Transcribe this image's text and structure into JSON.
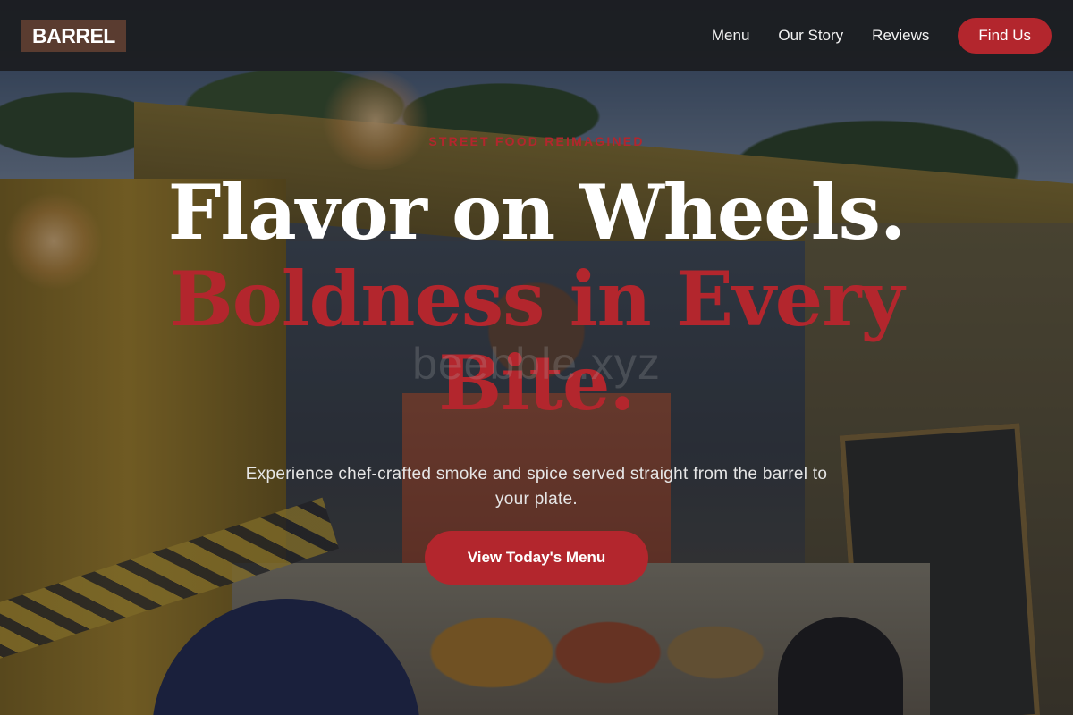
{
  "brand": {
    "logo_text": "BARREL"
  },
  "nav": {
    "links": [
      "Menu",
      "Our Story",
      "Reviews"
    ],
    "cta_label": "Find Us"
  },
  "hero": {
    "eyebrow": "STREET FOOD REIMAGINED",
    "headline_line1": "Flavor on Wheels.",
    "headline_line2": "Boldness in Every Bite.",
    "watermark": "beebble.xyz",
    "subtext": "Experience chef-crafted smoke and spice served straight from the barrel to your plate.",
    "cta_label": "View Today's Menu"
  },
  "colors": {
    "accent": "#b3262d",
    "header_bg": "#1c1e22",
    "logo_bg": "#5a3c30",
    "text_light": "#ffffff"
  }
}
